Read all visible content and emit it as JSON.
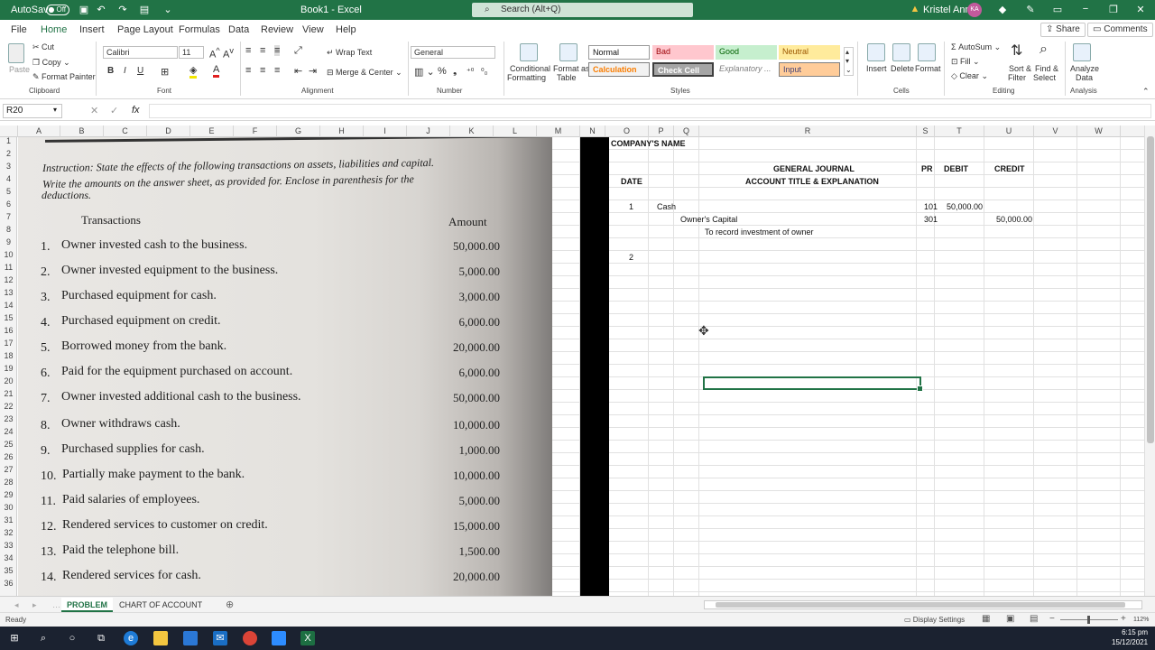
{
  "titlebar": {
    "autosave": "AutoSave",
    "autosave_state": "Off",
    "title": "Book1 - Excel",
    "search": "Search (Alt+Q)",
    "user": "Kristel Anne",
    "initials": "KA"
  },
  "tabs": [
    "File",
    "Home",
    "Insert",
    "Page Layout",
    "Formulas",
    "Data",
    "Review",
    "View",
    "Help"
  ],
  "share": "Share",
  "comments": "Comments",
  "ribbon": {
    "clipboard": {
      "paste": "Paste",
      "cut": "Cut",
      "copy": "Copy",
      "painter": "Format Painter",
      "label": "Clipboard"
    },
    "font": {
      "name": "Calibri",
      "size": "11",
      "label": "Font",
      "bold": "B",
      "italic": "I",
      "underline": "U"
    },
    "alignment": {
      "wrap": "Wrap Text",
      "merge": "Merge & Center",
      "label": "Alignment"
    },
    "number": {
      "format": "General",
      "label": "Number"
    },
    "styles": {
      "cond": "Conditional",
      "cond2": "Formatting",
      "fmt_table": "Format as",
      "fmt_table2": "Table",
      "normal": "Normal",
      "bad": "Bad",
      "good": "Good",
      "neutral": "Neutral",
      "calculation": "Calculation",
      "check": "Check Cell",
      "explanatory": "Explanatory ...",
      "input": "Input",
      "label": "Styles"
    },
    "cells": {
      "insert": "Insert",
      "delete": "Delete",
      "format": "Format",
      "label": "Cells"
    },
    "editing": {
      "autosum": "AutoSum",
      "fill": "Fill",
      "clear": "Clear",
      "sort": "Sort &",
      "sort2": "Filter",
      "find": "Find &",
      "find2": "Select",
      "label": "Editing"
    },
    "analysis": {
      "analyze": "Analyze",
      "analyze2": "Data",
      "label": "Analysis"
    }
  },
  "formula_bar": {
    "name_box": "R20",
    "fx": "fx"
  },
  "columns": [
    "A",
    "B",
    "C",
    "D",
    "E",
    "F",
    "G",
    "H",
    "I",
    "J",
    "K",
    "L",
    "M",
    "N",
    "O",
    "P",
    "Q",
    "R",
    "S",
    "T",
    "U",
    "V",
    "W"
  ],
  "rows": [
    "1",
    "2",
    "3",
    "4",
    "5",
    "6",
    "7",
    "8",
    "9",
    "10",
    "11",
    "12",
    "13",
    "14",
    "15",
    "16",
    "17",
    "18",
    "19",
    "20",
    "21",
    "22",
    "23",
    "24",
    "25",
    "26",
    "27",
    "28",
    "29",
    "30",
    "31",
    "32",
    "33",
    "34",
    "35",
    "36"
  ],
  "photo": {
    "instruction": [
      "Instruction: State the effects of the following transactions on assets, liabilities and capital.",
      "Write the amounts on the answer sheet, as provided for. Enclose in parenthesis for the",
      "deductions."
    ],
    "header_transactions": "Transactions",
    "header_amount": "Amount",
    "items": [
      {
        "n": "1.",
        "text": "Owner invested cash to the business.",
        "amt": "50,000.00"
      },
      {
        "n": "2.",
        "text": "Owner invested equipment to the business.",
        "amt": "5,000.00"
      },
      {
        "n": "3.",
        "text": "Purchased equipment for cash.",
        "amt": "3,000.00"
      },
      {
        "n": "4.",
        "text": "Purchased equipment on credit.",
        "amt": "6,000.00"
      },
      {
        "n": "5.",
        "text": "Borrowed money from the bank.",
        "amt": "20,000.00"
      },
      {
        "n": "6.",
        "text": "Paid for the equipment purchased on account.",
        "amt": "6,000.00"
      },
      {
        "n": "7.",
        "text": "Owner invested additional cash to the business.",
        "amt": "50,000.00"
      },
      {
        "n": "8.",
        "text": "Owner withdraws cash.",
        "amt": "10,000.00"
      },
      {
        "n": "9.",
        "text": "Purchased supplies for cash.",
        "amt": "1,000.00"
      },
      {
        "n": "10.",
        "text": "Partially make payment to the bank.",
        "amt": "10,000.00"
      },
      {
        "n": "11.",
        "text": "Paid salaries of employees.",
        "amt": "5,000.00"
      },
      {
        "n": "12.",
        "text": "Rendered services to customer on credit.",
        "amt": "15,000.00"
      },
      {
        "n": "13.",
        "text": "Paid the telephone bill.",
        "amt": "1,500.00"
      },
      {
        "n": "14.",
        "text": "Rendered services for cash.",
        "amt": "20,000.00"
      }
    ]
  },
  "journal": {
    "company": "COMPANY'S NAME",
    "title": "GENERAL JOURNAL",
    "date_hdr": "DATE",
    "acct_hdr": "ACCOUNT TITLE & EXPLANATION",
    "pr_hdr": "PR",
    "debit_hdr": "DEBIT",
    "credit_hdr": "CREDIT",
    "e1_day": "1",
    "e1_acct": "Cash",
    "e1_pr": "101",
    "e1_debit": "50,000.00",
    "e2_acct": "Owner's Capital",
    "e2_pr": "301",
    "e2_credit": "50,000.00",
    "e3_expl": "To record investment of owner",
    "e4_day": "2"
  },
  "sheets": [
    "PROBLEM",
    "CHART OF ACCOUNT"
  ],
  "status": {
    "ready": "Ready",
    "display": "Display Settings",
    "zoom": "112%"
  },
  "clock": {
    "time": "6:15 pm",
    "date": "15/12/2021"
  }
}
